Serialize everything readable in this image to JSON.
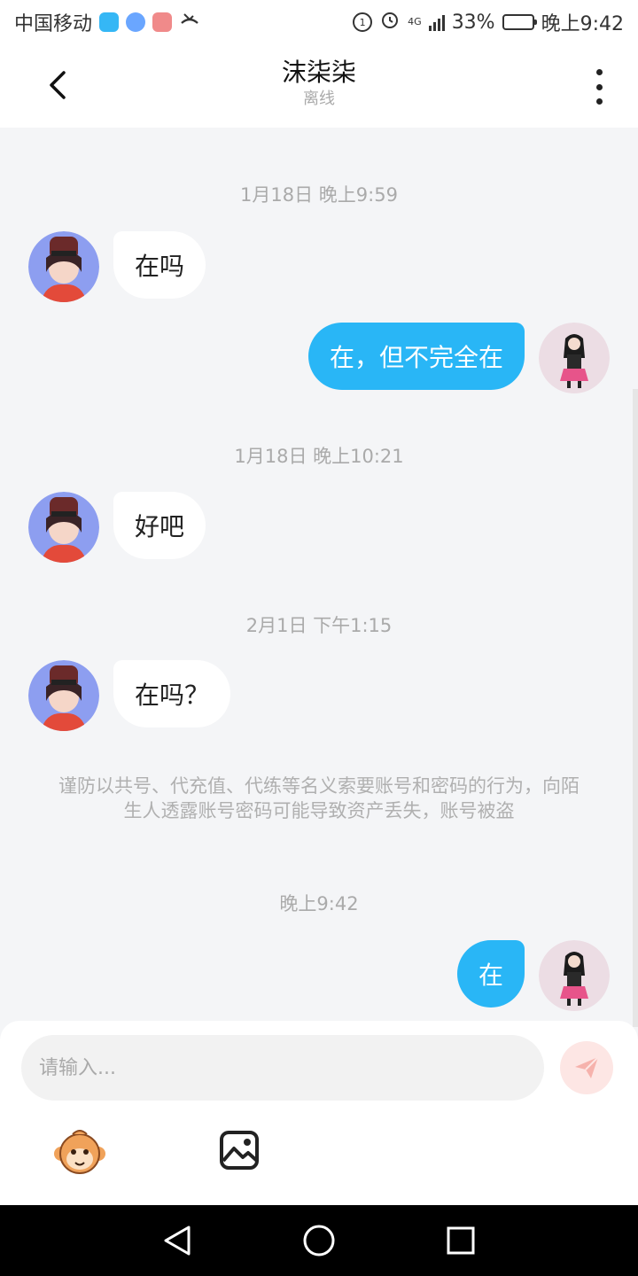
{
  "status_bar": {
    "carrier": "中国移动",
    "network": "4G",
    "battery": "33%",
    "battery_level": 0.33,
    "time": "晚上9:42"
  },
  "header": {
    "title": "沫柒柒",
    "subtitle": "离线"
  },
  "messages": [
    {
      "kind": "timestamp",
      "text": "1月18日 晚上9:59"
    },
    {
      "kind": "incoming",
      "text": "在吗"
    },
    {
      "kind": "outgoing",
      "text": "在，但不完全在"
    },
    {
      "kind": "timestamp",
      "text": "1月18日 晚上10:21"
    },
    {
      "kind": "incoming",
      "text": "好吧"
    },
    {
      "kind": "timestamp",
      "text": "2月1日 下午1:15"
    },
    {
      "kind": "incoming",
      "text": "在吗？"
    },
    {
      "kind": "notice",
      "text": "谨防以共号、代充值、代练等名义索要账号和密码的行为，向陌生人透露账号密码可能导致资产丢失，账号被盗"
    },
    {
      "kind": "timestamp",
      "text": "晚上9:42"
    },
    {
      "kind": "outgoing",
      "text": "在"
    }
  ],
  "composer": {
    "placeholder": "请输入..."
  },
  "icons": {
    "back": "chevron-left-icon",
    "more": "more-vertical-icon",
    "send": "paper-plane-icon",
    "emoji": "monkey-emoji-icon",
    "image": "image-icon",
    "nav_back": "triangle-back-icon",
    "nav_home": "circle-home-icon",
    "nav_recent": "square-recent-icon"
  },
  "colors": {
    "outgoing_bubble": "#29b6f6",
    "incoming_bubble": "#ffffff",
    "background": "#f4f5f7",
    "send_button": "#fde6e4",
    "timestamp_text": "#aaaaaa"
  }
}
